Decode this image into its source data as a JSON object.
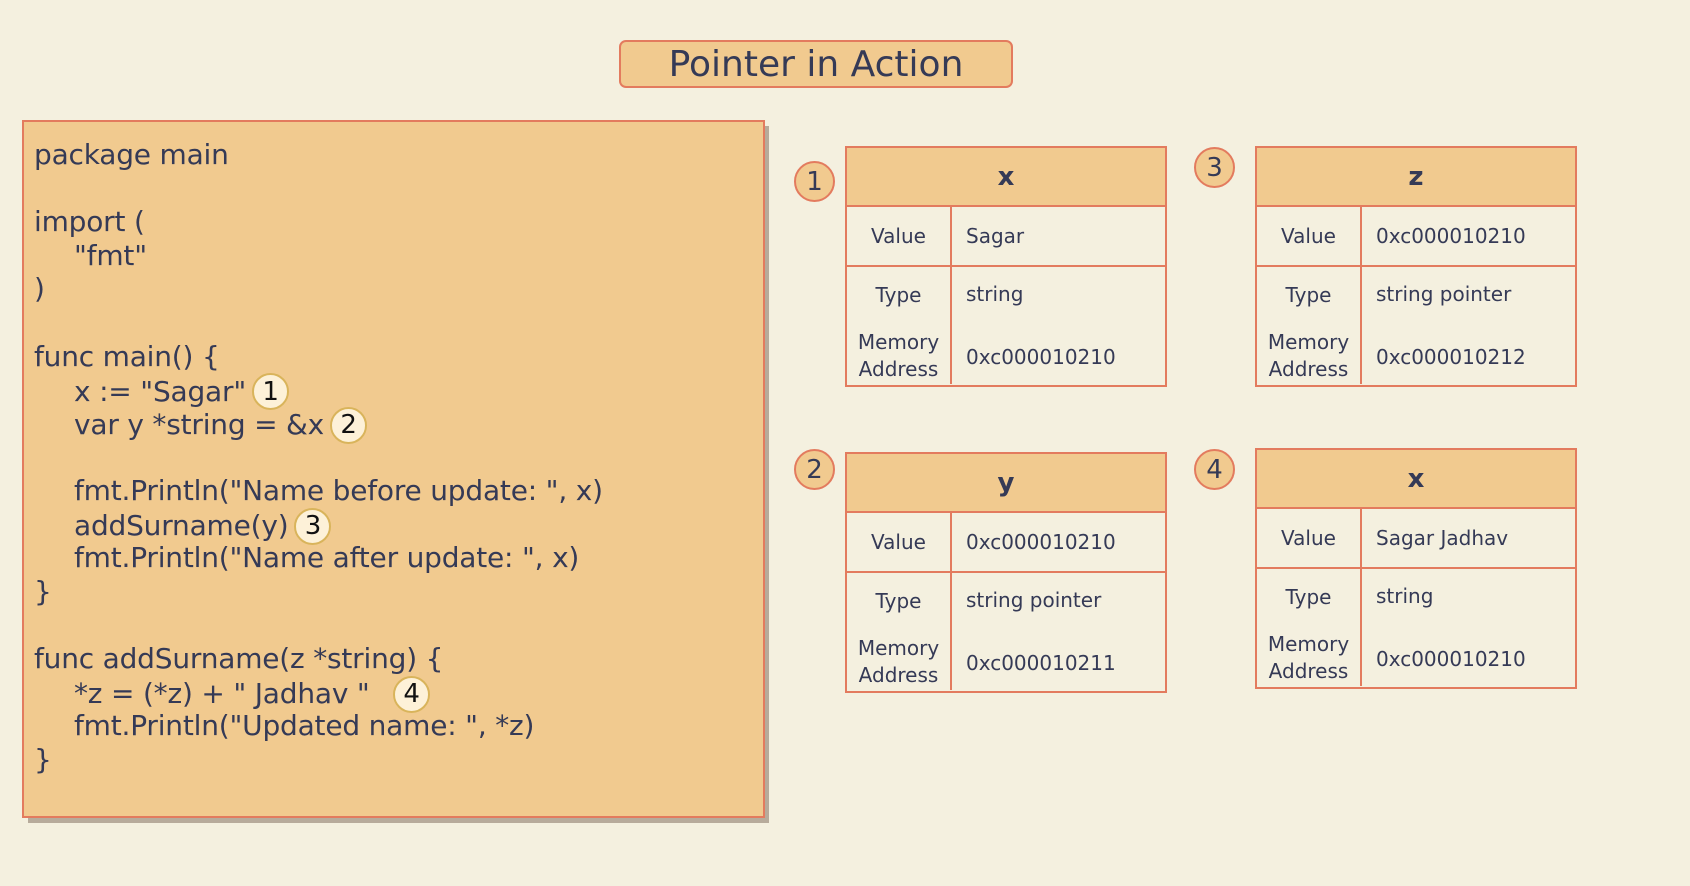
{
  "title": "Pointer in Action",
  "code": {
    "lines": [
      {
        "text": "package main",
        "indent": false,
        "marker": null
      },
      {
        "text": "",
        "indent": false,
        "marker": null
      },
      {
        "text": "import (",
        "indent": false,
        "marker": null
      },
      {
        "text": "\"fmt\"",
        "indent": true,
        "marker": null
      },
      {
        "text": ")",
        "indent": false,
        "marker": null
      },
      {
        "text": "",
        "indent": false,
        "marker": null
      },
      {
        "text": "func main() {",
        "indent": false,
        "marker": null
      },
      {
        "text": "x := \"Sagar\"",
        "indent": true,
        "marker": "1"
      },
      {
        "text": "var y *string = &x",
        "indent": true,
        "marker": "2"
      },
      {
        "text": "",
        "indent": false,
        "marker": null
      },
      {
        "text": "fmt.Println(\"Name before update: \", x)",
        "indent": true,
        "marker": null
      },
      {
        "text": "addSurname(y)",
        "indent": true,
        "marker": "3"
      },
      {
        "text": "fmt.Println(\"Name after update: \", x)",
        "indent": true,
        "marker": null
      },
      {
        "text": "}",
        "indent": false,
        "marker": null
      },
      {
        "text": "",
        "indent": false,
        "marker": null
      },
      {
        "text": "func addSurname(z *string) {",
        "indent": false,
        "marker": null
      },
      {
        "text": "*z = (*z) + \" Jadhav \"  ",
        "indent": true,
        "marker": "4"
      },
      {
        "text": "fmt.Println(\"Updated name: \", *z)",
        "indent": true,
        "marker": null
      },
      {
        "text": "}",
        "indent": false,
        "marker": null
      }
    ]
  },
  "labels": {
    "value": "Value",
    "type": "Type",
    "memory_line1": "Memory",
    "memory_line2": "Address"
  },
  "cards": [
    {
      "step": "1",
      "variable": "x",
      "value": "Sagar",
      "type": "string",
      "address": "0xc000010210"
    },
    {
      "step": "3",
      "variable": "z",
      "value": "0xc000010210",
      "type": "string pointer",
      "address": "0xc000010212"
    },
    {
      "step": "2",
      "variable": "y",
      "value": "0xc000010210",
      "type": "string pointer",
      "address": "0xc000010211"
    },
    {
      "step": "4",
      "variable": "x",
      "value": "Sagar Jadhav",
      "type": "string",
      "address": "0xc000010210"
    }
  ],
  "colors": {
    "background": "#f4f0df",
    "box_fill": "#f1ca8f",
    "border": "#e37b5e",
    "text": "#353a56",
    "marker_fill": "#fdf1d8",
    "marker_border": "#d9b45b"
  }
}
